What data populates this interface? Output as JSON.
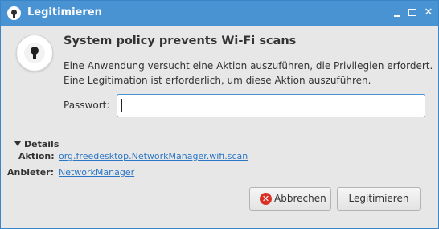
{
  "window": {
    "title": "Legitimieren"
  },
  "dialog": {
    "heading": "System policy prevents Wi-Fi scans",
    "description_line1": "Eine Anwendung versucht eine Aktion auszuführen, die Privilegien erfordert.",
    "description_line2": "Eine Legitimation ist erforderlich, um diese Aktion auszuführen.",
    "password_label": "Passwort:",
    "password_value": ""
  },
  "details": {
    "toggle_label": "Details",
    "action_label": "Aktion:",
    "action_value": "org.freedesktop.NetworkManager.wifi.scan",
    "vendor_label": "Anbieter:",
    "vendor_value": "NetworkManager"
  },
  "buttons": {
    "cancel_label": "Abbrechen",
    "authenticate_label": "Legitimieren"
  },
  "icons": {
    "window_icon": "lock-icon",
    "dialog_icon": "lock-icon",
    "cancel_icon": "cancel-icon",
    "details_toggle_icon": "triangle-down-icon"
  },
  "colors": {
    "titlebar": "#4a93d3",
    "link": "#2a76c6",
    "cancel_icon": "#d93025"
  }
}
